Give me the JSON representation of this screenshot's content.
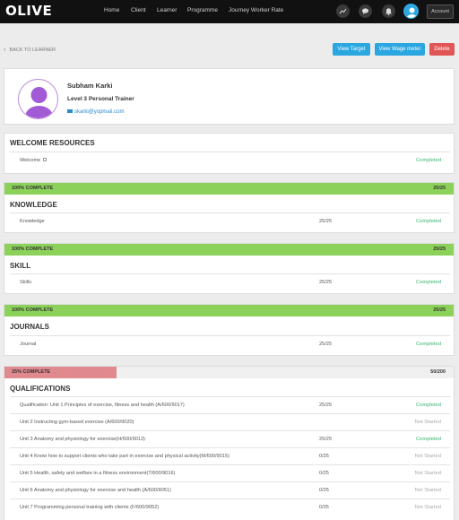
{
  "nav": {
    "logo": "OLIVE",
    "links": [
      "Home",
      "Client",
      "Learner",
      "Programme",
      "Journey Worker Rate"
    ],
    "icons": [
      "chart-icon",
      "chat-icon",
      "bell-icon"
    ],
    "account": "Account"
  },
  "actions": {
    "back": "BACK TO LEARNER",
    "view_target": "View Target",
    "view_wage": "View Wage meter",
    "delete": "Delete"
  },
  "profile": {
    "name": "Subham Karki",
    "level": "Level 3 Personal Trainer",
    "email": "skarki@yopmail.com"
  },
  "colors": {
    "complete_bar": "#8cd15a",
    "partial_bar": "#e08a8f",
    "completed_text": "#3cb371",
    "not_started_text": "#aaaaaa",
    "accent_blue": "#2aa6e0",
    "delete_red": "#e05555"
  },
  "sections": {
    "welcome": {
      "title": "WELCOME RESOURCES",
      "rows": [
        {
          "label": "Welcome",
          "count": "",
          "status": "Completed"
        }
      ]
    },
    "knowledge": {
      "progress": "100% COMPLETE",
      "progress_count": "25/25",
      "title": "KNOWLEDGE",
      "rows": [
        {
          "label": "Knowledge",
          "count": "25/25",
          "status": "Completed"
        }
      ]
    },
    "skill": {
      "progress": "100% COMPLETE",
      "progress_count": "25/25",
      "title": "SKILL",
      "rows": [
        {
          "label": "Skills",
          "count": "25/25",
          "status": "Completed"
        }
      ]
    },
    "journals": {
      "progress": "100% COMPLETE",
      "progress_count": "25/25",
      "title": "JOURNALS",
      "rows": [
        {
          "label": "Journal",
          "count": "25/25",
          "status": "Completed"
        }
      ]
    },
    "qualifications": {
      "progress": "25% COMPLETE",
      "progress_fraction": 0.25,
      "progress_count": "50/200",
      "title": "QUALIFICATIONS",
      "rows": [
        {
          "label": "Qualification: Unit 1 Principles of exercise, fitness and health (A/600/9017)",
          "count": "25/25",
          "status": "Completed"
        },
        {
          "label": "Unit 2 Instructing gym-based exercise (A/600/9020)",
          "count": "",
          "status": "Not Started"
        },
        {
          "label": "Unit 3 Anatomy and physiology for exercise(H/600/9013)",
          "count": "25/25",
          "status": "Completed"
        },
        {
          "label": "Unit 4 Know how to support clients who take part in exercise and physical activity(M/600/9015)",
          "count": "0/25",
          "status": "Not Started"
        },
        {
          "label": "Unit 5 Health, safety and welfare in a fitness environment(T/600/9016)",
          "count": "0/25",
          "status": "Not Started"
        },
        {
          "label": "Unit 6 Anatomy and physiology for exercise and health (A/600/9051)",
          "count": "0/25",
          "status": "Not Started"
        },
        {
          "label": "Unit 7 Programming personal training with clients (F/600/9052)",
          "count": "0/25",
          "status": "Not Started"
        }
      ]
    }
  }
}
